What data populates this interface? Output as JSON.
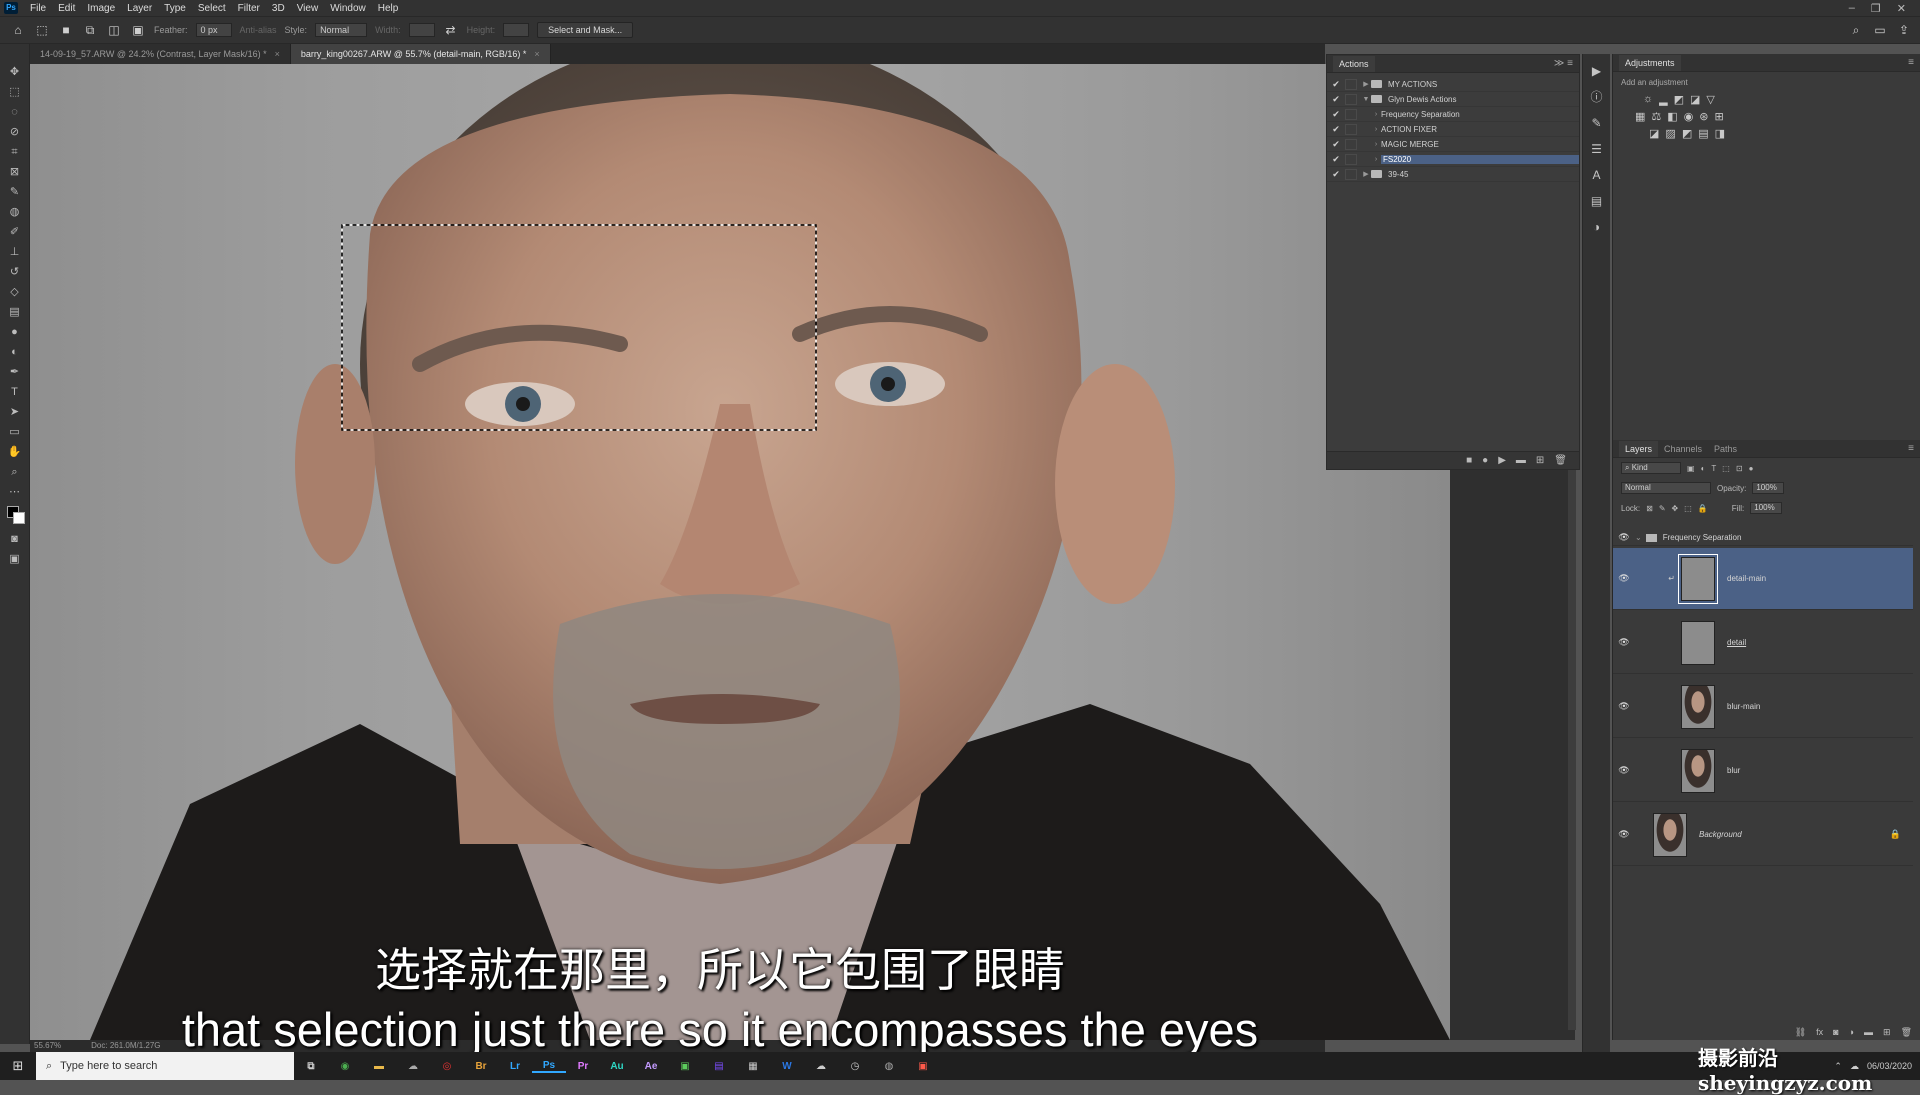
{
  "menubar": {
    "app_icon": "ps-logo",
    "items": [
      "File",
      "Edit",
      "Image",
      "Layer",
      "Type",
      "Select",
      "Filter",
      "3D",
      "View",
      "Window",
      "Help"
    ]
  },
  "options_bar": {
    "feather_label": "Feather:",
    "feather_value": "0 px",
    "antialias_label": "Anti-alias",
    "style_label": "Style:",
    "style_value": "Normal",
    "width_label": "Width:",
    "height_label": "Height:",
    "select_mask_label": "Select and Mask..."
  },
  "tabs": [
    {
      "label": "14-09-19_57.ARW @ 24.2% (Contrast, Layer Mask/16) *",
      "active": false
    },
    {
      "label": "barry_king00267.ARW @ 55.7% (detail-main, RGB/16) *",
      "active": true
    }
  ],
  "statusbar": {
    "zoom": "55.67%",
    "doc": "Doc: 261.0M/1.27G"
  },
  "actions_panel": {
    "title": "Actions",
    "rows": [
      {
        "label": "MY ACTIONS",
        "indent": 0,
        "folder": true
      },
      {
        "label": "Glyn Dewis Actions",
        "indent": 0,
        "folder": true
      },
      {
        "label": "Frequency Separation",
        "indent": 1,
        "folder": false
      },
      {
        "label": "ACTION FIXER",
        "indent": 1,
        "folder": false
      },
      {
        "label": "MAGIC MERGE",
        "indent": 1,
        "folder": false
      },
      {
        "label": "FS2020",
        "indent": 1,
        "folder": false,
        "selected": true
      },
      {
        "label": "39-45",
        "indent": 0,
        "folder": true
      }
    ]
  },
  "adjustments_panel": {
    "title": "Adjustments",
    "subtitle": "Add an adjustment"
  },
  "layers_panel": {
    "tabs": [
      "Layers",
      "Channels",
      "Paths"
    ],
    "filter_value": "Kind",
    "blend_mode": "Normal",
    "opacity_label": "Opacity:",
    "opacity_value": "100%",
    "lock_label": "Lock:",
    "fill_label": "Fill:",
    "fill_value": "100%",
    "group_name": "Frequency Separation",
    "layers": [
      {
        "name": "detail-main",
        "selected": true,
        "thumb": "gray"
      },
      {
        "name": "detail",
        "selected": false,
        "thumb": "gray"
      },
      {
        "name": "blur-main",
        "selected": false,
        "thumb": "portrait"
      },
      {
        "name": "blur",
        "selected": false,
        "thumb": "portrait"
      },
      {
        "name": "Background",
        "selected": false,
        "thumb": "portrait",
        "locked": true
      }
    ]
  },
  "subtitles": {
    "chinese": "选择就在那里，所以它包围了眼睛",
    "english": "that selection just there so it encompasses the eyes"
  },
  "watermark": "摄影前沿 sheyingzyz.com",
  "taskbar": {
    "search_placeholder": "Type here to search",
    "apps": [
      "Br",
      "Lr",
      "Ps",
      "Pr",
      "Au",
      "Ae"
    ],
    "date": "06/03/2020"
  },
  "colors": {
    "panel_bg": "#3a3a3a",
    "selected_row": "#4b6186",
    "ps_blue": "#31a8ff"
  }
}
